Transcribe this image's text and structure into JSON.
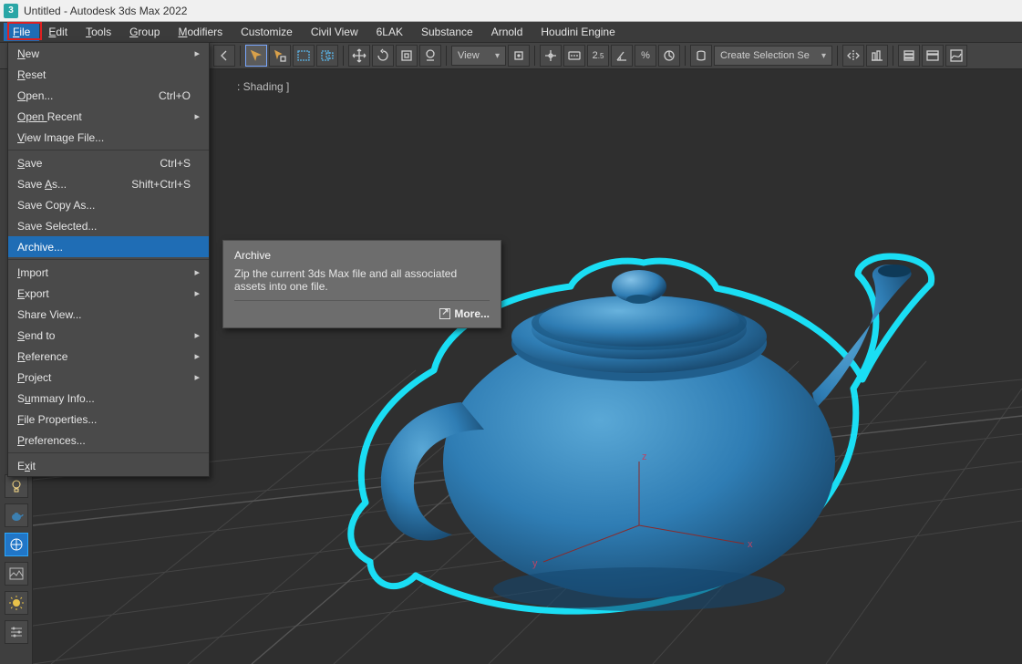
{
  "window": {
    "title": "Untitled - Autodesk 3ds Max 2022",
    "logo_text": "3"
  },
  "menubar": {
    "items": [
      {
        "label": "File",
        "ul": "F"
      },
      {
        "label": "Edit",
        "ul": "E"
      },
      {
        "label": "Tools",
        "ul": "T"
      },
      {
        "label": "Group",
        "ul": "G"
      },
      {
        "label": "Modifiers",
        "ul": "M"
      },
      {
        "label": "Customize"
      },
      {
        "label": "Civil View"
      },
      {
        "label": "6LAK"
      },
      {
        "label": "Substance"
      },
      {
        "label": "Arnold"
      },
      {
        "label": "Houdini Engine"
      }
    ]
  },
  "file_menu": {
    "groups": [
      [
        {
          "label": "New",
          "ul": "N",
          "submenu": true
        },
        {
          "label": "Reset",
          "ul": "R"
        },
        {
          "label": "Open...",
          "ul": "O",
          "shortcut": "Ctrl+O"
        },
        {
          "label": "Open Recent",
          "ul": "Open ",
          "submenu": true
        },
        {
          "label": "View Image File...",
          "ul": "V"
        }
      ],
      [
        {
          "label": "Save",
          "ul": "S",
          "shortcut": "Ctrl+S"
        },
        {
          "label": "Save As...",
          "ul": "A",
          "shortcut": "Shift+Ctrl+S"
        },
        {
          "label": "Save Copy As..."
        },
        {
          "label": "Save Selected..."
        },
        {
          "label": "Archive...",
          "highlight": true
        }
      ],
      [
        {
          "label": "Import",
          "ul": "I",
          "submenu": true
        },
        {
          "label": "Export",
          "ul": "E",
          "submenu": true
        },
        {
          "label": "Share View..."
        },
        {
          "label": "Send to",
          "ul": "S",
          "submenu": true
        },
        {
          "label": "Reference",
          "ul": "R",
          "submenu": true
        },
        {
          "label": "Project",
          "ul": "P",
          "submenu": true
        },
        {
          "label": "Summary Info...",
          "ul": "u"
        },
        {
          "label": "File Properties...",
          "ul": "F"
        },
        {
          "label": "Preferences...",
          "ul": "P"
        }
      ],
      [
        {
          "label": "Exit",
          "ul": "x"
        }
      ]
    ]
  },
  "tooltip": {
    "title": "Archive",
    "body": "Zip the current 3ds Max file and all associated assets into one file.",
    "more": "More..."
  },
  "toolbar": {
    "view_label": "View",
    "selection_set_label": "Create Selection Se",
    "zoom_text": "2.5"
  },
  "viewport": {
    "label": ": Shading ]",
    "gizmo": {
      "x": "x",
      "y": "y",
      "z": "z"
    }
  }
}
